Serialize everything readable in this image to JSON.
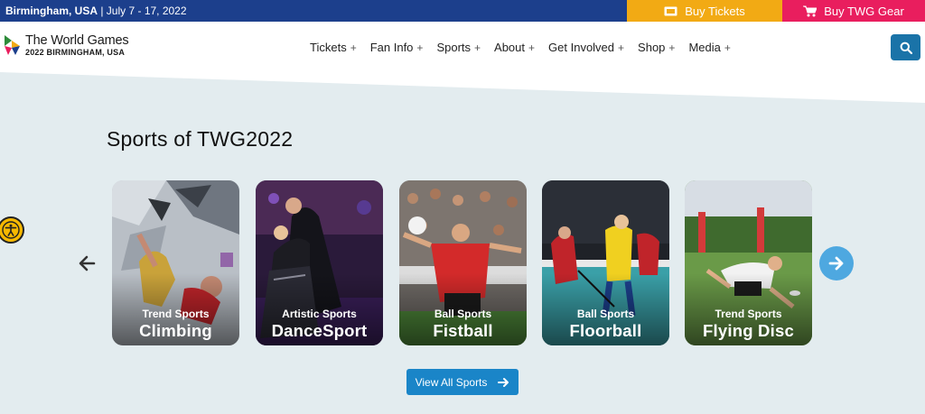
{
  "topbar": {
    "location": "Birmingham, USA",
    "dates": "| July 7 - 17, 2022",
    "buy_tickets": "Buy Tickets",
    "buy_gear": "Buy TWG Gear"
  },
  "header": {
    "logo_title": "The World Games",
    "logo_subtitle": "2022 BIRMINGHAM, USA",
    "nav": [
      {
        "label": "Tickets"
      },
      {
        "label": "Fan Info"
      },
      {
        "label": "Sports"
      },
      {
        "label": "About"
      },
      {
        "label": "Get Involved"
      },
      {
        "label": "Shop"
      },
      {
        "label": "Media"
      }
    ],
    "nav_expand_symbol": "+"
  },
  "section": {
    "title": "Sports of TWG2022",
    "view_all": "View All Sports"
  },
  "cards": [
    {
      "category": "Trend Sports",
      "name": "Climbing"
    },
    {
      "category": "Artistic Sports",
      "name": "DanceSport"
    },
    {
      "category": "Ball Sports",
      "name": "Fistball"
    },
    {
      "category": "Ball Sports",
      "name": "Floorball"
    },
    {
      "category": "Trend Sports",
      "name": "Flying Disc"
    }
  ],
  "colors": {
    "topbar": "#1c3f8c",
    "tickets": "#f2aa14",
    "gear": "#e91e5e",
    "accent_blue": "#1a85c8",
    "background": "#e3ecef"
  },
  "icons": [
    "ticket-icon",
    "cart-icon",
    "search-icon",
    "accessibility-icon",
    "arrow-left-icon",
    "arrow-right-icon"
  ]
}
